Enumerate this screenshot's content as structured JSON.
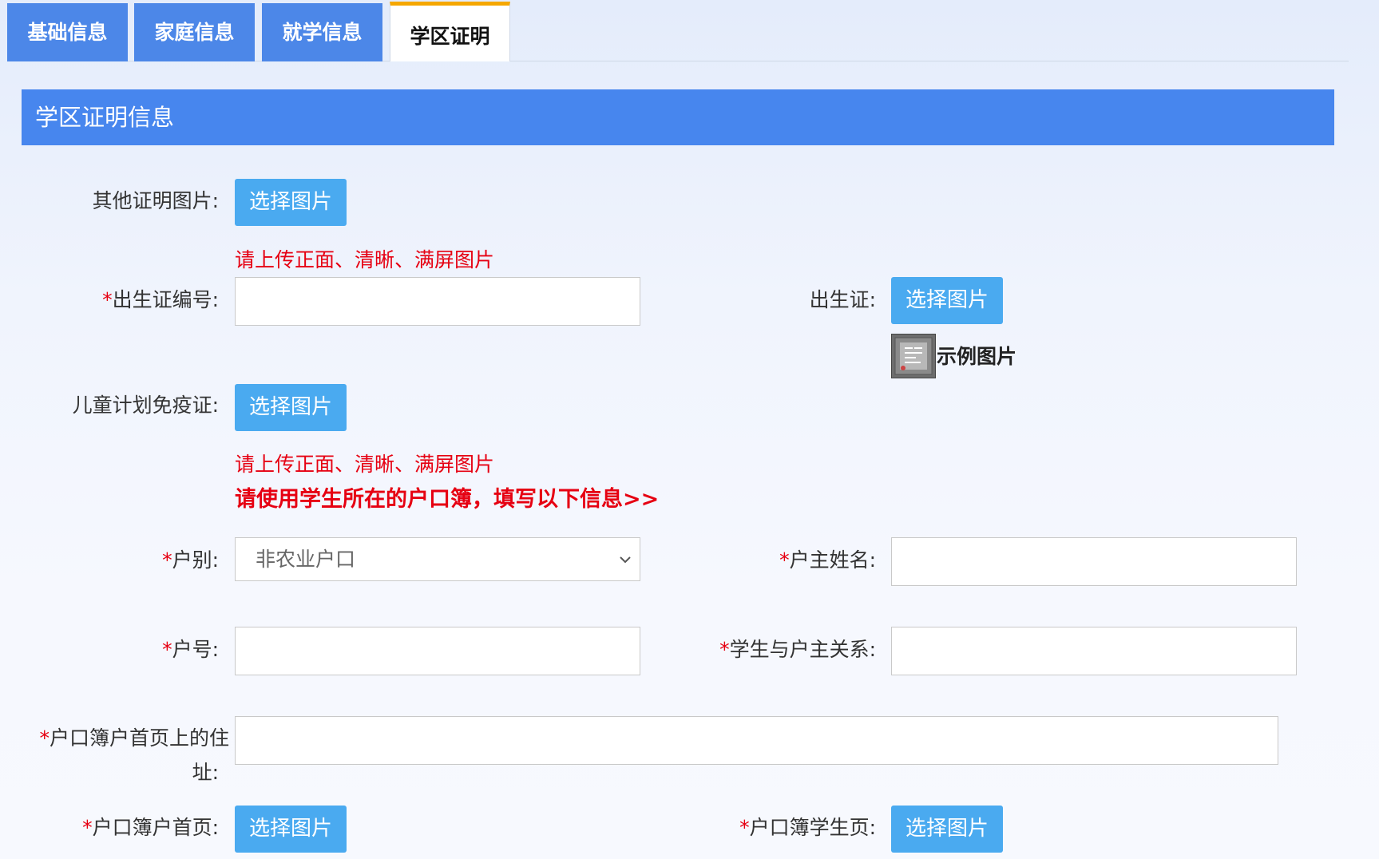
{
  "tabs": [
    {
      "label": "基础信息"
    },
    {
      "label": "家庭信息"
    },
    {
      "label": "就学信息"
    },
    {
      "label": "学区证明"
    }
  ],
  "section": {
    "title": "学区证明信息"
  },
  "common": {
    "select_image": "选择图片",
    "required_mark": "*"
  },
  "form": {
    "other_proof_label": "其他证明图片:",
    "upload_hint": "请上传正面、清晰、满屏图片",
    "birth_cert_no_label": "出生证编号:",
    "birth_cert_label": "出生证:",
    "sample_image_label": "示例图片",
    "vaccine_label": "儿童计划免疫证:",
    "household_notice": "请使用学生所在的户口簿，填写以下信息>>",
    "household_type_label": "户别:",
    "household_type_value": "非农业户口",
    "householder_name_label": "户主姓名:",
    "household_no_label": "户号:",
    "relation_label": "学生与户主关系:",
    "address_label_line1": "户口簿户首页上的住",
    "address_label_line2": "址:",
    "household_first_page_label": "户口簿户首页:",
    "household_student_page_label": "户口簿学生页:"
  },
  "colors": {
    "tab_bg": "#4c87e8",
    "tab_active_border": "#f5a700",
    "header_bg": "#4786ee",
    "button_bg": "#4aaaf0",
    "required": "#e60012"
  }
}
